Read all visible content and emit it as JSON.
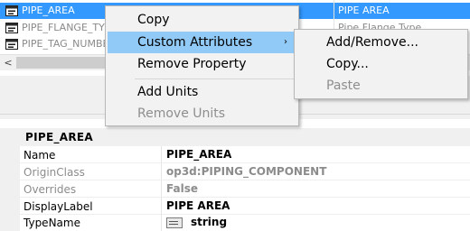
{
  "list": {
    "rows": [
      {
        "name": "PIPE_AREA",
        "value": "PIPE AREA"
      },
      {
        "name": "PIPE_FLANGE_TYPE",
        "value": "Pipe Flange Type"
      },
      {
        "name": "PIPE_TAG_NUMBER",
        "value": ""
      }
    ],
    "scroll_left_glyph": "<"
  },
  "context_menu": {
    "items": [
      "Copy",
      "Custom Attributes",
      "Remove Property",
      "Add Units",
      "Remove Units"
    ],
    "submenu_arrow": "›"
  },
  "submenu": {
    "items": [
      "Add/Remove...",
      "Copy...",
      "Paste"
    ]
  },
  "grid": {
    "header": "PIPE_AREA",
    "rows": [
      {
        "name": "Name",
        "value": "PIPE_AREA"
      },
      {
        "name": "OriginClass",
        "value": "op3d:PIPING_COMPONENT"
      },
      {
        "name": "Overrides",
        "value": "False"
      },
      {
        "name": "DisplayLabel",
        "value": "PIPE AREA"
      },
      {
        "name": "TypeName",
        "value": "string"
      }
    ]
  },
  "colors": {
    "selection": "#3399ff",
    "menu_highlight": "#91c9f7"
  }
}
